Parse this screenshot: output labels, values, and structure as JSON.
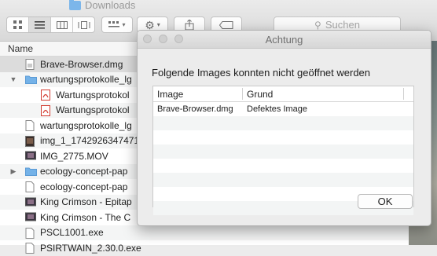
{
  "finder": {
    "title": "Downloads",
    "search_placeholder": "Suchen",
    "column_name": "Name",
    "files": [
      {
        "name": "Brave-Browser.dmg",
        "icon": "disk-image-icon",
        "disclosure": "",
        "indent": 0,
        "selected": true
      },
      {
        "name": "wartungsprotokolle_lg",
        "icon": "folder-icon",
        "disclosure": "▼",
        "indent": 0
      },
      {
        "name": "Wartungsprotokol",
        "icon": "pdf-icon",
        "disclosure": "",
        "indent": 1
      },
      {
        "name": "Wartungsprotokol",
        "icon": "pdf-icon",
        "disclosure": "",
        "indent": 1
      },
      {
        "name": "wartungsprotokolle_lg",
        "icon": "document-icon",
        "disclosure": "",
        "indent": 0
      },
      {
        "name": "img_1_1742926347471",
        "icon": "image-icon",
        "disclosure": "",
        "indent": 0
      },
      {
        "name": "IMG_2775.MOV",
        "icon": "video-icon",
        "disclosure": "",
        "indent": 0
      },
      {
        "name": "ecology-concept-pap",
        "icon": "folder-icon",
        "disclosure": "▶",
        "indent": 0
      },
      {
        "name": "ecology-concept-pap",
        "icon": "document-icon",
        "disclosure": "",
        "indent": 0
      },
      {
        "name": "King Crimson - Epitap",
        "icon": "video-icon",
        "disclosure": "",
        "indent": 0
      },
      {
        "name": "King Crimson - The C",
        "icon": "video-icon",
        "disclosure": "",
        "indent": 0
      },
      {
        "name": "PSCL1001.exe",
        "icon": "document-icon",
        "disclosure": "",
        "indent": 0
      },
      {
        "name": "PSIRTWAIN_2.30.0.exe",
        "icon": "document-icon",
        "disclosure": "",
        "indent": 0
      }
    ]
  },
  "dialog": {
    "title": "Achtung",
    "message": "Folgende Images konnten nicht geöffnet werden",
    "columns": [
      "Image",
      "Grund"
    ],
    "rows": [
      {
        "image": "Brave-Browser.dmg",
        "reason": "Defektes Image"
      }
    ],
    "empty_rows": 7,
    "ok_label": "OK"
  }
}
